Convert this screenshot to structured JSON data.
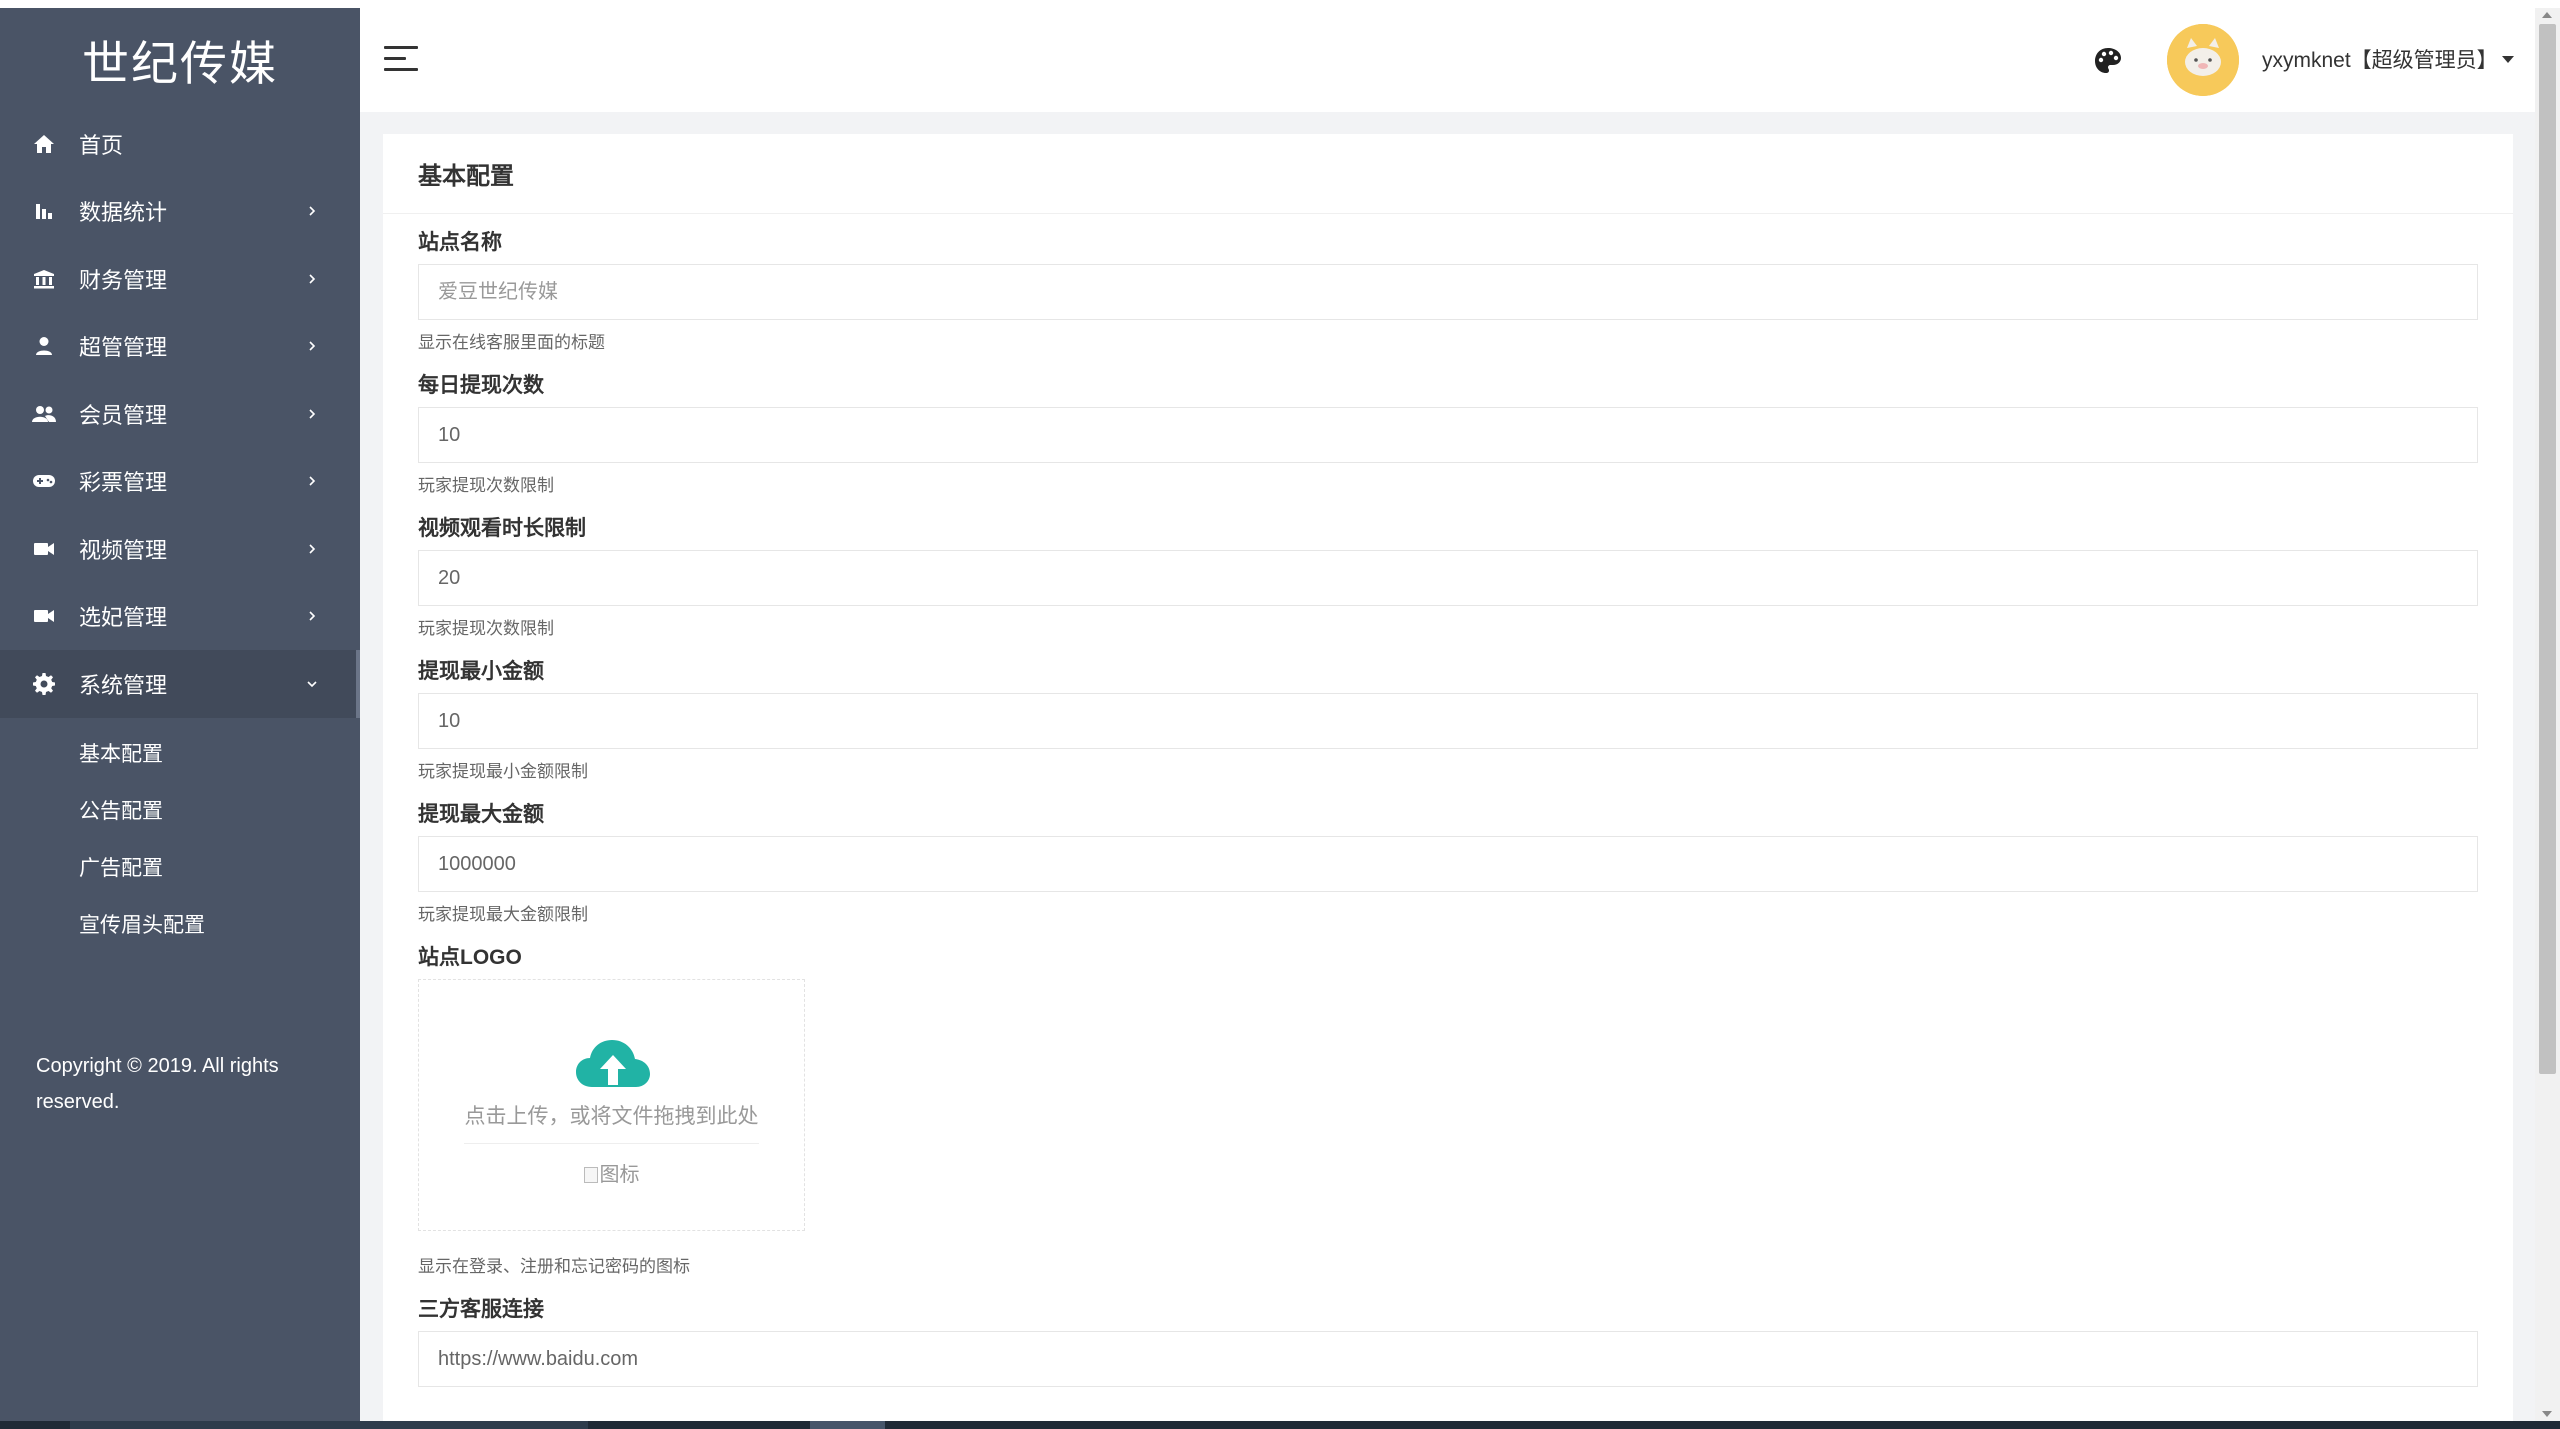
{
  "brand": {
    "title": "世纪传媒"
  },
  "sidebar": {
    "items": [
      {
        "label": "首页",
        "icon": "home-icon",
        "has_children": false
      },
      {
        "label": "数据统计",
        "icon": "bar-chart-icon",
        "has_children": true
      },
      {
        "label": "财务管理",
        "icon": "bank-icon",
        "has_children": true
      },
      {
        "label": "超管管理",
        "icon": "user-icon",
        "has_children": true
      },
      {
        "label": "会员管理",
        "icon": "users-icon",
        "has_children": true
      },
      {
        "label": "彩票管理",
        "icon": "gamepad-icon",
        "has_children": true
      },
      {
        "label": "视频管理",
        "icon": "video-icon",
        "has_children": true
      },
      {
        "label": "选妃管理",
        "icon": "video-icon",
        "has_children": true
      },
      {
        "label": "系统管理",
        "icon": "gear-icon",
        "has_children": true,
        "expanded": true
      }
    ],
    "submenu": [
      {
        "label": "基本配置"
      },
      {
        "label": "公告配置"
      },
      {
        "label": "广告配置"
      },
      {
        "label": "宣传眉头配置"
      }
    ],
    "copyright": "Copyright © 2019. All rights reserved."
  },
  "header": {
    "user_label": "yxymknet【超级管理员】",
    "icons": [
      "menu-toggle-icon",
      "palette-icon",
      "avatar",
      "caret-down-icon"
    ]
  },
  "card": {
    "title": "基本配置",
    "fields": [
      {
        "label": "站点名称",
        "value": "",
        "placeholder": "爱豆世纪传媒",
        "help": "显示在线客服里面的标题"
      },
      {
        "label": "每日提现次数",
        "value": "10",
        "placeholder": "",
        "help": "玩家提现次数限制"
      },
      {
        "label": "视频观看时长限制",
        "value": "20",
        "placeholder": "",
        "help": "玩家提现次数限制"
      },
      {
        "label": "提现最小金额",
        "value": "10",
        "placeholder": "",
        "help": "玩家提现最小金额限制"
      },
      {
        "label": "提现最大金额",
        "value": "1000000",
        "placeholder": "",
        "help": "玩家提现最大金额限制"
      }
    ],
    "logo": {
      "label": "站点LOGO",
      "upload_text": "点击上传，或将文件拖拽到此处",
      "preview_alt": "图标",
      "help": "显示在登录、注册和忘记密码的图标"
    },
    "service": {
      "label": "三方客服连接",
      "value": "https://www.baidu.com"
    }
  },
  "colors": {
    "sidebar_bg": "#4a5466",
    "sidebar_active_bg": "#414a5a",
    "page_bg": "#f2f3f5",
    "accent_teal": "#21b3a5",
    "avatar_bg": "#f7c95a"
  }
}
